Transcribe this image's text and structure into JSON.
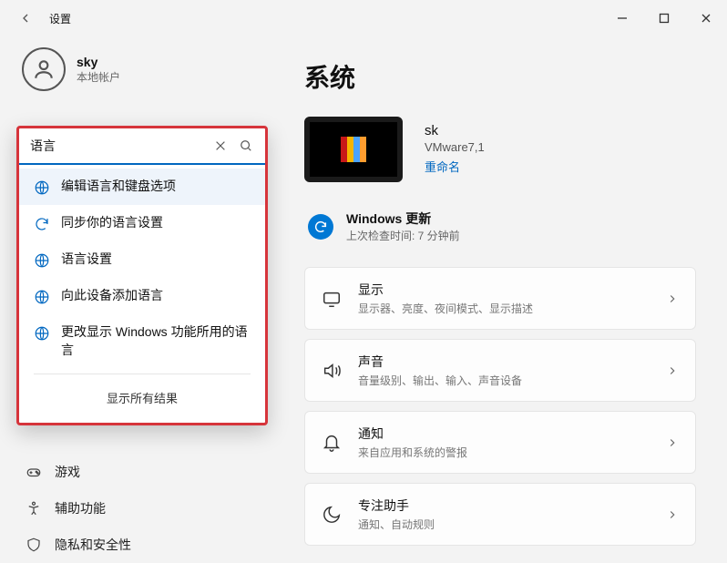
{
  "window": {
    "title": "设置"
  },
  "account": {
    "name": "sky",
    "type": "本地帐户"
  },
  "search": {
    "value": "语言",
    "suggestions": [
      "编辑语言和键盘选项",
      "同步你的语言设置",
      "语言设置",
      "向此设备添加语言",
      "更改显示 Windows 功能所用的语言"
    ],
    "show_all": "显示所有结果"
  },
  "nav_visible": {
    "gaming": "游戏",
    "accessibility": "辅助功能",
    "privacy": "隐私和安全性"
  },
  "main": {
    "title": "系统",
    "device": {
      "name": "sk",
      "model": "VMware7,1",
      "rename": "重命名"
    },
    "update": {
      "title": "Windows 更新",
      "sub": "上次检查时间: 7 分钟前"
    },
    "cards": [
      {
        "key": "display",
        "title": "显示",
        "sub": "显示器、亮度、夜间模式、显示描述"
      },
      {
        "key": "sound",
        "title": "声音",
        "sub": "音量级别、输出、输入、声音设备"
      },
      {
        "key": "notifications",
        "title": "通知",
        "sub": "来自应用和系统的警报"
      },
      {
        "key": "focus",
        "title": "专注助手",
        "sub": "通知、自动规则"
      }
    ]
  }
}
